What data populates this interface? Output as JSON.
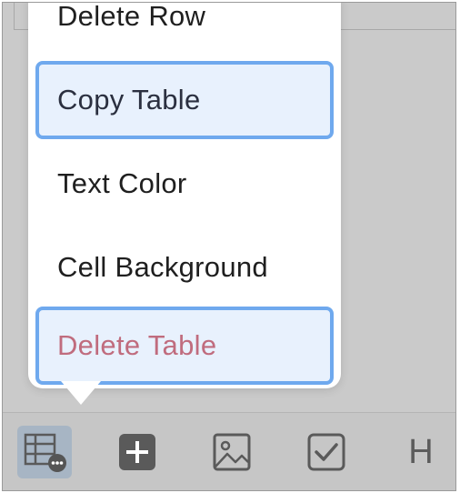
{
  "menu": {
    "items": [
      {
        "label": "Delete Row"
      },
      {
        "label": "Copy Table"
      },
      {
        "label": "Text Color"
      },
      {
        "label": "Cell Background"
      },
      {
        "label": "Delete Table"
      }
    ]
  },
  "toolbar": {
    "heading_label": "H",
    "icons": [
      "table-more-icon",
      "add-icon",
      "image-icon",
      "checkbox-icon",
      "heading-icon"
    ]
  },
  "colors": {
    "accent": "#6fa9ee",
    "highlight_bg": "#e8f1fd",
    "danger": "#c06c7e"
  }
}
